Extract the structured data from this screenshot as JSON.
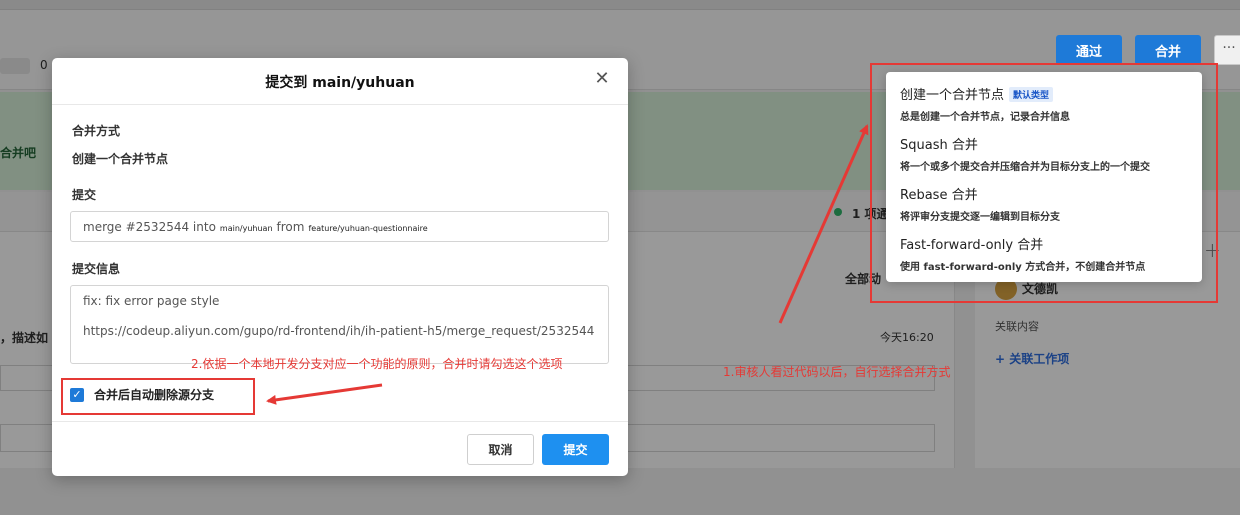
{
  "background": {
    "banner_text": "合并吧",
    "count_text": "1 项通",
    "activity_label": "全部动",
    "left_desc": "，描述如",
    "time": "今天16:20",
    "chip_text": "0",
    "reviewer_name": "文德凯",
    "related_label": "关联内容",
    "link_work_item": "+ 关联工作项"
  },
  "top_actions": {
    "pass_label": "通过",
    "merge_label": "合并",
    "more_label": "···"
  },
  "merge_menu": {
    "items": [
      {
        "title": "创建一个合并节点",
        "badge": "默认类型",
        "desc": "总是创建一个合并节点，记录合并信息"
      },
      {
        "title": "Squash 合并",
        "badge": "",
        "desc": "将一个或多个提交合并压缩合并为目标分支上的一个提交"
      },
      {
        "title": "Rebase 合并",
        "badge": "",
        "desc": "将评审分支提交逐一编辑到目标分支"
      },
      {
        "title": "Fast-forward-only 合并",
        "badge": "",
        "desc": "使用 fast-forward-only 方式合并，不创建合并节点"
      }
    ]
  },
  "modal": {
    "title": "提交到 main/yuhuan",
    "merge_method_label": "合并方式",
    "merge_method_value": "创建一个合并节点",
    "commit_label": "提交",
    "commit": {
      "prefix": "merge #2532544 into",
      "target_branch": "main/yuhuan",
      "from_word": "from",
      "source_branch": "feature/yuhuan-questionnaire"
    },
    "commit_message_label": "提交信息",
    "commit_message": "fix: fix error page style\n\nhttps://codeup.aliyun.com/gupo/rd-frontend/ih/ih-patient-h5/merge_request/2532544",
    "delete_source_label": "合并后自动删除源分支",
    "delete_source_checked": true,
    "cancel_label": "取消",
    "submit_label": "提交"
  },
  "annotations": {
    "note_checkbox": "2.依据一个本地开发分支对应一个功能的原则，合并时请勾选这个选项",
    "note_merge_method": "1.审核人看过代码以后，自行选择合并方式"
  },
  "colors": {
    "primary": "#1e7ad8",
    "submit": "#1e90f0",
    "annotation_red": "#e53935",
    "badge_bg": "#e2ecfb"
  }
}
